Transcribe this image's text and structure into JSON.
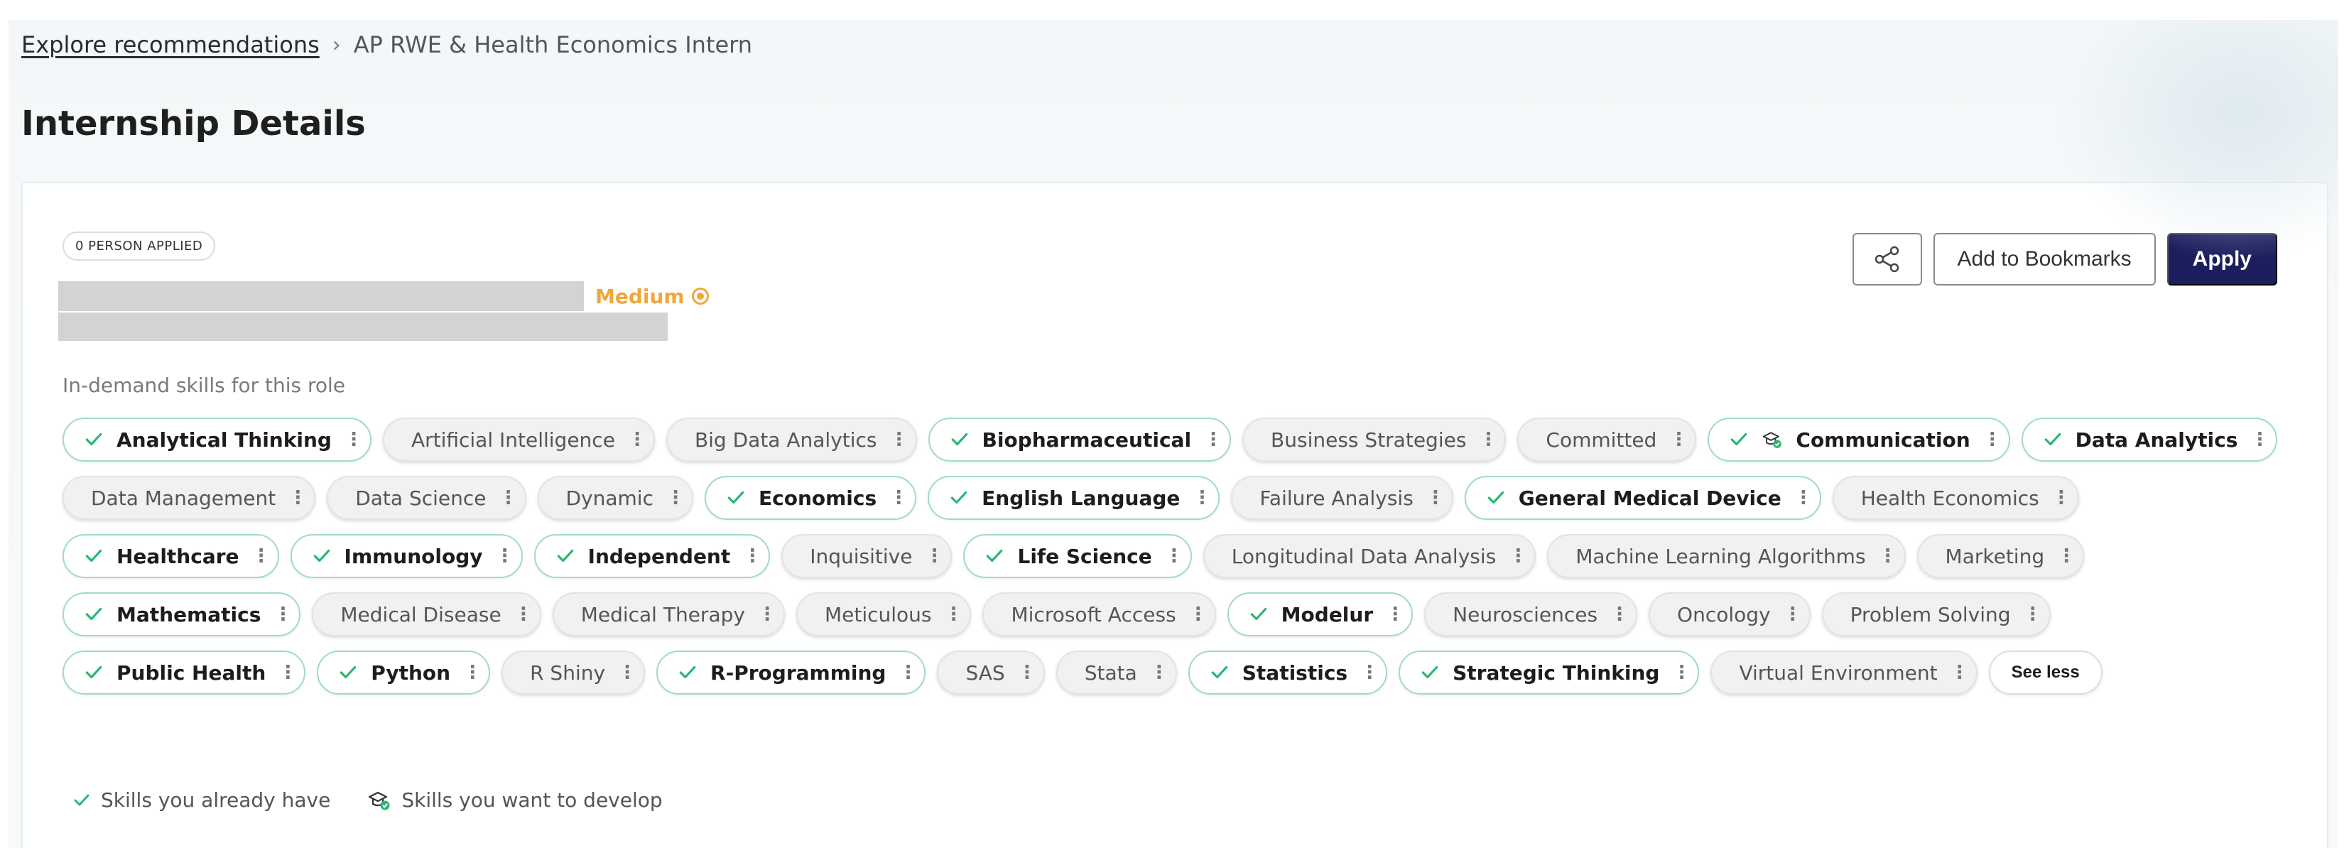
{
  "breadcrumb": {
    "link": "Explore recommendations",
    "separator": "›",
    "current": "AP RWE & Health Economics Intern"
  },
  "page_title": "Internship Details",
  "card": {
    "applied_badge": "0 PERSON APPLIED",
    "difficulty": {
      "label": "Medium",
      "color": "#f0a63a"
    },
    "actions": {
      "share_icon": "share-icon",
      "bookmark_label": "Add to Bookmarks",
      "apply_label": "Apply"
    },
    "skills_heading": "In-demand skills for this role",
    "skills": [
      {
        "label": "Analytical Thinking",
        "status": "have"
      },
      {
        "label": "Artificial Intelligence",
        "status": "none"
      },
      {
        "label": "Big Data Analytics",
        "status": "none"
      },
      {
        "label": "Biopharmaceutical",
        "status": "have"
      },
      {
        "label": "Business Strategies",
        "status": "none"
      },
      {
        "label": "Committed",
        "status": "none"
      },
      {
        "label": "Communication",
        "status": "have-develop"
      },
      {
        "label": "Data Analytics",
        "status": "have"
      },
      {
        "label": "Data Management",
        "status": "none"
      },
      {
        "label": "Data Science",
        "status": "none"
      },
      {
        "label": "Dynamic",
        "status": "none"
      },
      {
        "label": "Economics",
        "status": "have"
      },
      {
        "label": "English Language",
        "status": "have"
      },
      {
        "label": "Failure Analysis",
        "status": "none"
      },
      {
        "label": "General Medical Device",
        "status": "have"
      },
      {
        "label": "Health Economics",
        "status": "none"
      },
      {
        "label": "Healthcare",
        "status": "have"
      },
      {
        "label": "Immunology",
        "status": "have"
      },
      {
        "label": "Independent",
        "status": "have"
      },
      {
        "label": "Inquisitive",
        "status": "none"
      },
      {
        "label": "Life Science",
        "status": "have"
      },
      {
        "label": "Longitudinal Data Analysis",
        "status": "none"
      },
      {
        "label": "Machine Learning Algorithms",
        "status": "none"
      },
      {
        "label": "Marketing",
        "status": "none"
      },
      {
        "label": "Mathematics",
        "status": "have"
      },
      {
        "label": "Medical Disease",
        "status": "none"
      },
      {
        "label": "Medical Therapy",
        "status": "none"
      },
      {
        "label": "Meticulous",
        "status": "none"
      },
      {
        "label": "Microsoft Access",
        "status": "none"
      },
      {
        "label": "Modelur",
        "status": "have"
      },
      {
        "label": "Neurosciences",
        "status": "none"
      },
      {
        "label": "Oncology",
        "status": "none"
      },
      {
        "label": "Problem Solving",
        "status": "none"
      },
      {
        "label": "Public Health",
        "status": "have"
      },
      {
        "label": "Python",
        "status": "have"
      },
      {
        "label": "R Shiny",
        "status": "none"
      },
      {
        "label": "R-Programming",
        "status": "have"
      },
      {
        "label": "SAS",
        "status": "none"
      },
      {
        "label": "Stata",
        "status": "none"
      },
      {
        "label": "Statistics",
        "status": "have"
      },
      {
        "label": "Strategic Thinking",
        "status": "have"
      },
      {
        "label": "Virtual Environment",
        "status": "none"
      }
    ],
    "see_less_label": "See less",
    "legend": {
      "have": "Skills you already have",
      "develop": "Skills you want to develop"
    }
  },
  "colors": {
    "check": "#2bb673",
    "apply_bg": "#1b1f5e",
    "have_border": "#9fdcc2",
    "medium": "#f0a63a"
  }
}
